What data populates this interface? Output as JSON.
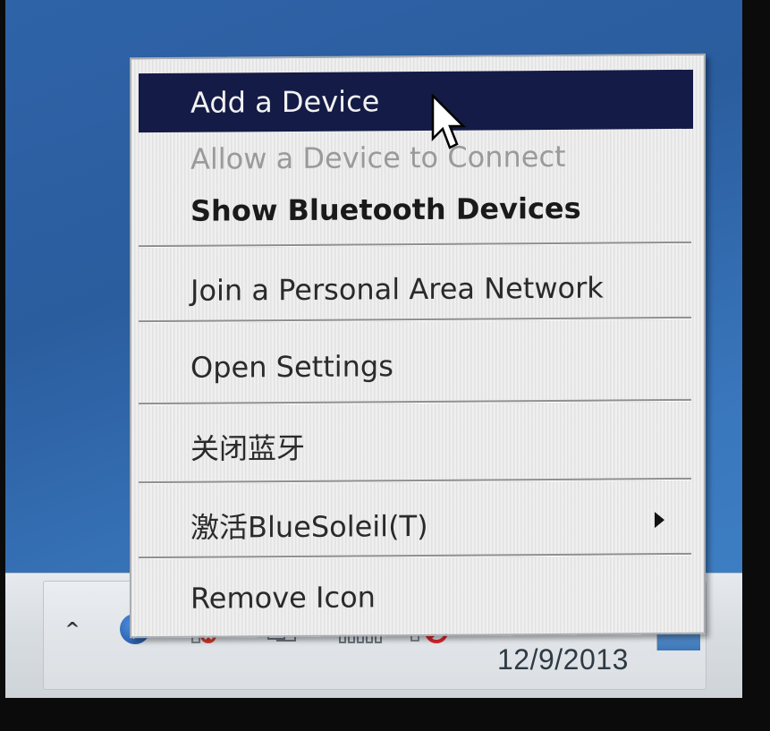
{
  "menu": {
    "items": [
      {
        "label": "Add a Device",
        "state": "highlighted"
      },
      {
        "label": "Allow a Device to Connect",
        "state": "disabled"
      },
      {
        "label": "Show Bluetooth Devices",
        "state": "default-bold"
      },
      {
        "label": "Join a Personal Area Network",
        "state": "normal"
      },
      {
        "label": "Open Settings",
        "state": "normal"
      },
      {
        "label": "关闭蓝牙",
        "state": "normal"
      },
      {
        "label": "激活BlueSoleil(T)",
        "state": "normal",
        "has_submenu": true
      },
      {
        "label": "Remove Icon",
        "state": "normal"
      }
    ],
    "highlight_color": "#141b46"
  },
  "taskbar": {
    "show_hidden_glyph": "^",
    "clock_date": "12/9/2013",
    "tray_icons": [
      "bluetooth-icon",
      "network-disconnected-icon",
      "action-center-icon",
      "signal-strength-icon",
      "volume-muted-icon"
    ]
  },
  "colors": {
    "desktop": "#2f63a8",
    "taskbar": "#d8dde2"
  }
}
